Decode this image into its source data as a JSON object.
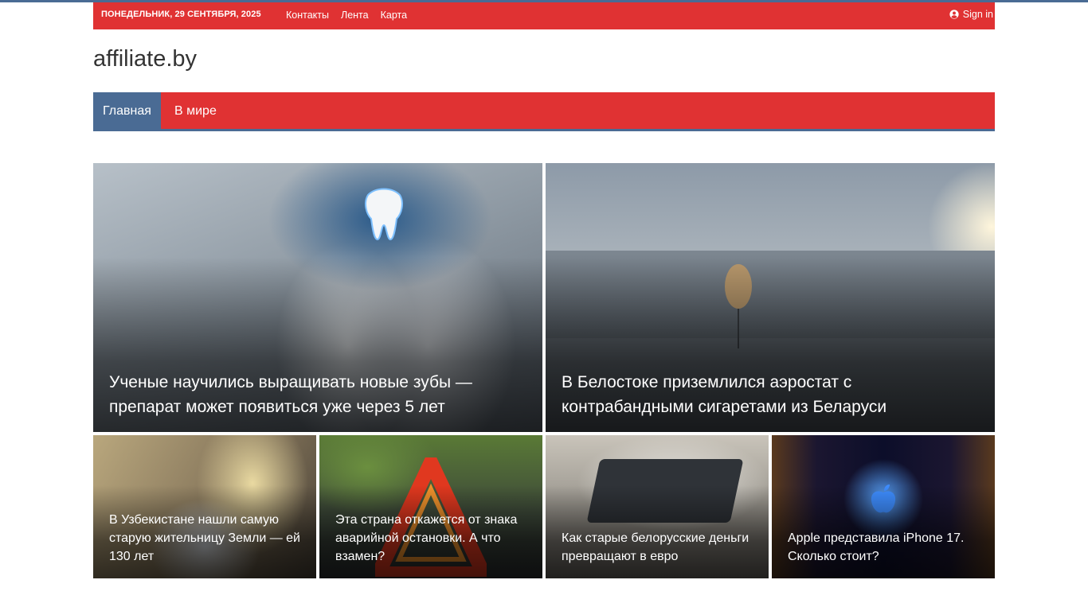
{
  "topbar": {
    "date": "ПОНЕДЕЛЬНИК, 29 СЕНТЯБРЯ, 2025",
    "links": [
      "Контакты",
      "Лента",
      "Карта"
    ],
    "signin": "Sign in",
    "icon": "user-circle-icon"
  },
  "site": {
    "title": "affiliate.by"
  },
  "nav": {
    "items": [
      "Главная",
      "В мире"
    ]
  },
  "articles": {
    "big": [
      {
        "title": "Ученые научились выращивать новые зубы — препарат может появиться уже через 5 лет"
      },
      {
        "title": "В Белостоке приземлился аэростат с контрабандными сигаретами из Беларуси"
      }
    ],
    "small": [
      {
        "title": "В Узбекистане нашли самую старую жительницу Земли — ей 130 лет"
      },
      {
        "title": "Эта страна откажется от знака аварийной остановки. А что взамен?"
      },
      {
        "title": "Как старые белорусские деньги превращают в евро"
      },
      {
        "title": "Apple представила iPhone 17. Сколько стоит?"
      }
    ]
  },
  "colors": {
    "accent": "#e03233",
    "secondary": "#4a6b94"
  }
}
